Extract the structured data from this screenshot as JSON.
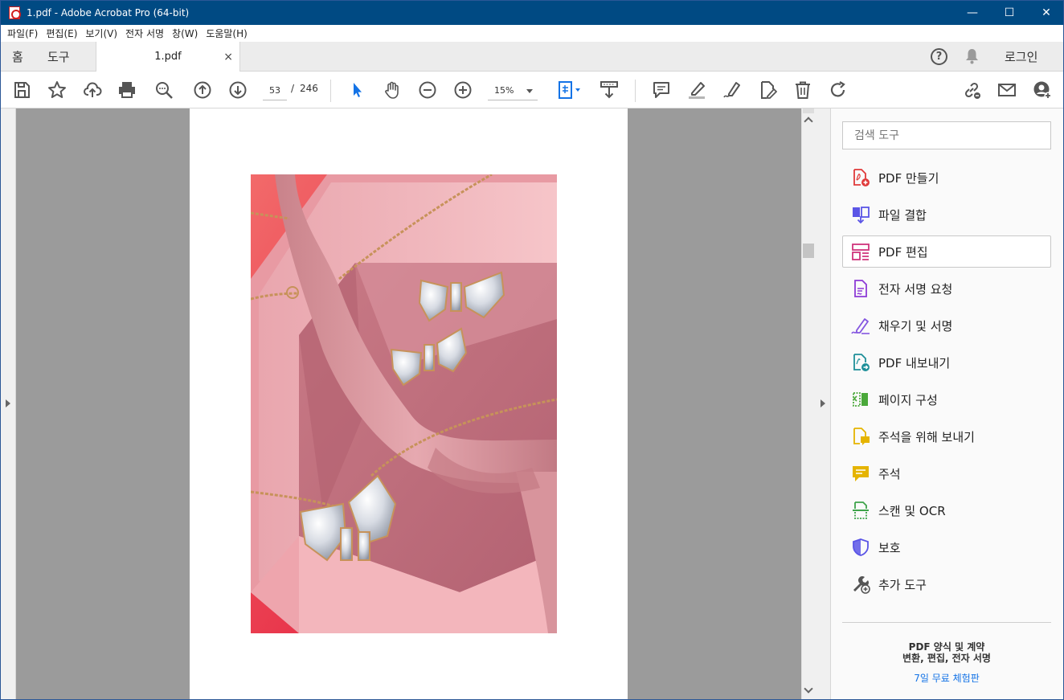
{
  "window": {
    "title": "1.pdf - Adobe Acrobat Pro (64-bit)",
    "minimize": "—",
    "maximize": "☐",
    "close": "✕"
  },
  "menu": [
    "파일(F)",
    "편집(E)",
    "보기(V)",
    "전자 서명",
    "창(W)",
    "도움말(H)"
  ],
  "tabs": {
    "home": "홈",
    "tools": "도구",
    "document": "1.pdf",
    "close_glyph": "×",
    "login": "로그인",
    "help_glyph": "?"
  },
  "toolbar": {
    "current_page": "53",
    "page_separator": "/",
    "total_pages": "246",
    "zoom": "15%"
  },
  "tools_pane": {
    "search_placeholder": "검색 도구",
    "items": [
      {
        "label": "PDF 만들기",
        "icon": "create-pdf-icon",
        "color": "#e03a3a"
      },
      {
        "label": "파일 결합",
        "icon": "combine-files-icon",
        "color": "#5b55e6"
      },
      {
        "label": "PDF 편집",
        "icon": "edit-pdf-icon",
        "color": "#d0347c"
      },
      {
        "label": "전자 서명 요청",
        "icon": "request-signature-icon",
        "color": "#8d3bd6"
      },
      {
        "label": "채우기 및 서명",
        "icon": "fill-sign-icon",
        "color": "#8456e0"
      },
      {
        "label": "PDF 내보내기",
        "icon": "export-pdf-icon",
        "color": "#1e8f99"
      },
      {
        "label": "페이지 구성",
        "icon": "organize-pages-icon",
        "color": "#4aa83a"
      },
      {
        "label": "주석을 위해 보내기",
        "icon": "send-for-comments-icon",
        "color": "#e5b400"
      },
      {
        "label": "주석",
        "icon": "comment-icon",
        "color": "#e5b400"
      },
      {
        "label": "스캔 및 OCR",
        "icon": "scan-ocr-icon",
        "color": "#3ea34a"
      },
      {
        "label": "보호",
        "icon": "protect-icon",
        "color": "#5b55e6"
      },
      {
        "label": "추가 도구",
        "icon": "more-tools-icon",
        "color": "#555555"
      }
    ],
    "active_index": 2,
    "promo_line1": "PDF 양식 및 계약",
    "promo_line2": "변환, 편집, 전자 서명",
    "promo_link": "7일 무료 체험판"
  },
  "colors": {
    "titlebar": "#004a83",
    "accent_blue": "#1473e6",
    "canvas_gray": "#9b9b9b"
  }
}
